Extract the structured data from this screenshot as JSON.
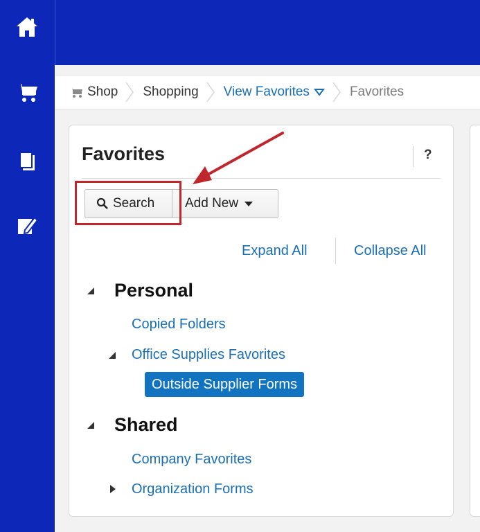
{
  "nav": {
    "items": [
      {
        "id": "home",
        "icon": "home-icon"
      },
      {
        "id": "shop",
        "icon": "cart-icon"
      },
      {
        "id": "documents",
        "icon": "documents-icon"
      },
      {
        "id": "edit",
        "icon": "edit-icon"
      }
    ],
    "color": "#0d28b8"
  },
  "breadcrumb": {
    "items": [
      {
        "label": "Shop",
        "icon": "cart-icon"
      },
      {
        "label": "Shopping"
      },
      {
        "label": "View Favorites",
        "dropdown": true
      },
      {
        "label": "Favorites"
      }
    ]
  },
  "panel": {
    "title": "Favorites",
    "help": "?",
    "toolbar": {
      "search_label": "Search",
      "add_new_label": "Add New"
    },
    "links": {
      "expand_all": "Expand All",
      "collapse_all": "Collapse All"
    },
    "tree": {
      "personal": {
        "label": "Personal",
        "children": {
          "copied_folders": "Copied Folders",
          "office_supplies": {
            "label": "Office Supplies Favorites",
            "children": {
              "outside_supplier_forms": "Outside Supplier Forms"
            }
          }
        }
      },
      "shared": {
        "label": "Shared",
        "children": {
          "company_favorites": "Company Favorites",
          "organization_forms": "Organization Forms"
        }
      }
    }
  },
  "colors": {
    "link": "#1a6fb4",
    "selected": "#1273c1",
    "annotation": "#c0272d"
  }
}
